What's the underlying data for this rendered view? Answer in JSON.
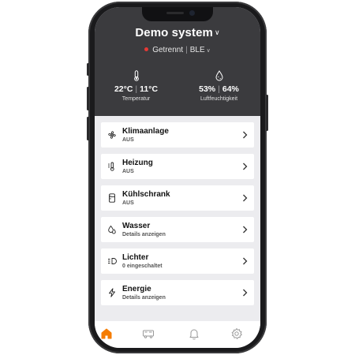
{
  "header": {
    "title": "Demo system",
    "status_dot_color": "#e53935",
    "status_text": "Getrennt",
    "connection": "BLE",
    "temperature": {
      "value1": "22°C",
      "value2": "11°C",
      "label": "Temperatur",
      "icon": "thermometer-icon"
    },
    "humidity": {
      "value1": "53%",
      "value2": "64%",
      "label": "Luftfeuchtigkeit",
      "icon": "droplet-icon"
    }
  },
  "devices": [
    {
      "name": "Klimaanlage",
      "status": "AUS",
      "icon": "fan-icon"
    },
    {
      "name": "Heizung",
      "status": "AUS",
      "icon": "heater-icon"
    },
    {
      "name": "Kühlschrank",
      "status": "AUS",
      "icon": "fridge-icon"
    },
    {
      "name": "Wasser",
      "status": "Details anzeigen",
      "icon": "water-icon"
    },
    {
      "name": "Lichter",
      "status": "0 eingeschaltet",
      "icon": "light-icon"
    },
    {
      "name": "Energie",
      "status": "Details anzeigen",
      "icon": "lightning-icon"
    }
  ],
  "tabbar": {
    "active_color": "#f57c00",
    "tabs": [
      "home-icon",
      "vehicle-icon",
      "bell-icon",
      "gear-icon"
    ]
  }
}
